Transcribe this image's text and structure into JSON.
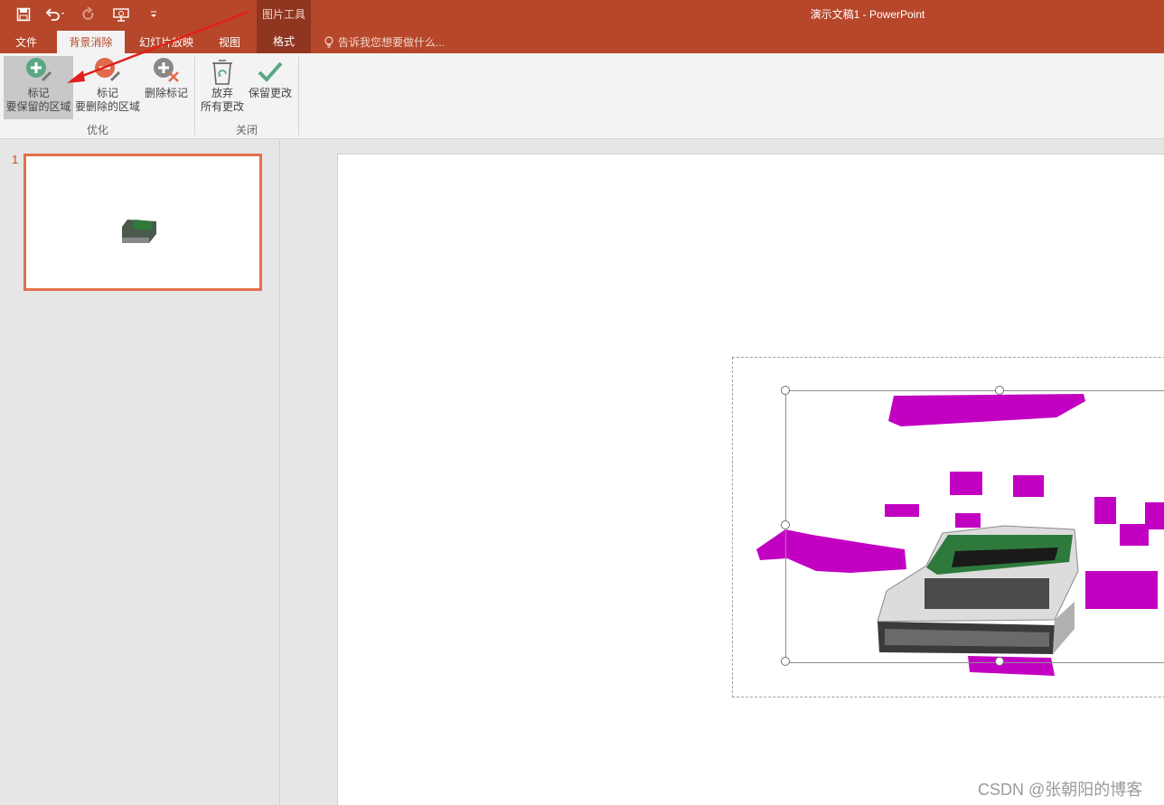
{
  "window": {
    "title": "演示文稿1 - PowerPoint",
    "context_group": "图片工具"
  },
  "qat": {
    "save_icon": "save-icon",
    "undo_icon": "undo-icon",
    "redo_icon": "redo-icon",
    "slideshow_icon": "slideshow-from-start-icon",
    "customize_icon": "customize-qat-icon"
  },
  "tabs": [
    {
      "label": "文件"
    },
    {
      "label": "背景消除"
    },
    {
      "label": "幻灯片放映"
    },
    {
      "label": "视图"
    },
    {
      "label": "格式"
    }
  ],
  "tellme": {
    "label": "告诉我您想要做什么..."
  },
  "ribbon": {
    "mark_keep": {
      "line1": "标记",
      "line2": "要保留的区域"
    },
    "mark_remove": {
      "line1": "标记",
      "line2": "要删除的区域"
    },
    "delete_mark": {
      "label": "删除标记"
    },
    "discard": {
      "line1": "放弃",
      "line2": "所有更改"
    },
    "keep_changes": {
      "label": "保留更改"
    },
    "group_refine": "优化",
    "group_close": "关闭"
  },
  "slides": [
    {
      "number": "1"
    }
  ],
  "colors": {
    "brand": "#b7472a",
    "context_tab": "#8f3520",
    "thumb_border": "#e3704d",
    "removal_mask": "#c200c2"
  },
  "watermark": "CSDN @张朝阳的博客"
}
